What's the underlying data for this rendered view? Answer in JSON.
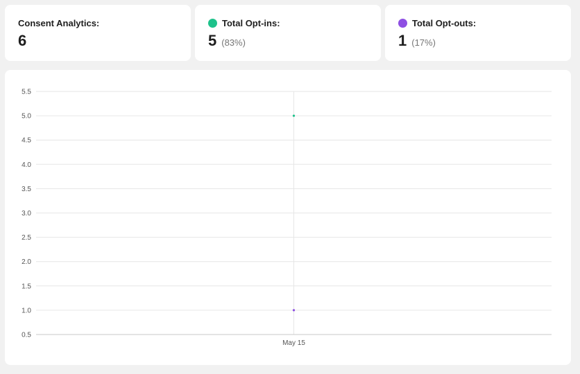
{
  "stats": {
    "total": {
      "label": "Consent Analytics:",
      "value": "6"
    },
    "optins": {
      "label": "Total Opt-ins:",
      "value": "5",
      "pct": "(83%)",
      "color": "#1ec28b"
    },
    "optouts": {
      "label": "Total Opt-outs:",
      "value": "1",
      "pct": "(17%)",
      "color": "#8e4fe3"
    }
  },
  "chart_data": {
    "type": "scatter",
    "categories": [
      "May 15"
    ],
    "series": [
      {
        "name": "Total Opt-ins:",
        "color": "#1ec28b",
        "values": [
          5
        ]
      },
      {
        "name": "Total Opt-outs:",
        "color": "#8e4fe3",
        "values": [
          1
        ]
      }
    ],
    "ylim": [
      0.5,
      5.5
    ],
    "yticks": [
      "0.5",
      "1.0",
      "1.5",
      "2.0",
      "2.5",
      "3.0",
      "3.5",
      "4.0",
      "4.5",
      "5.0",
      "5.5"
    ],
    "grid": true,
    "legend": "none"
  }
}
